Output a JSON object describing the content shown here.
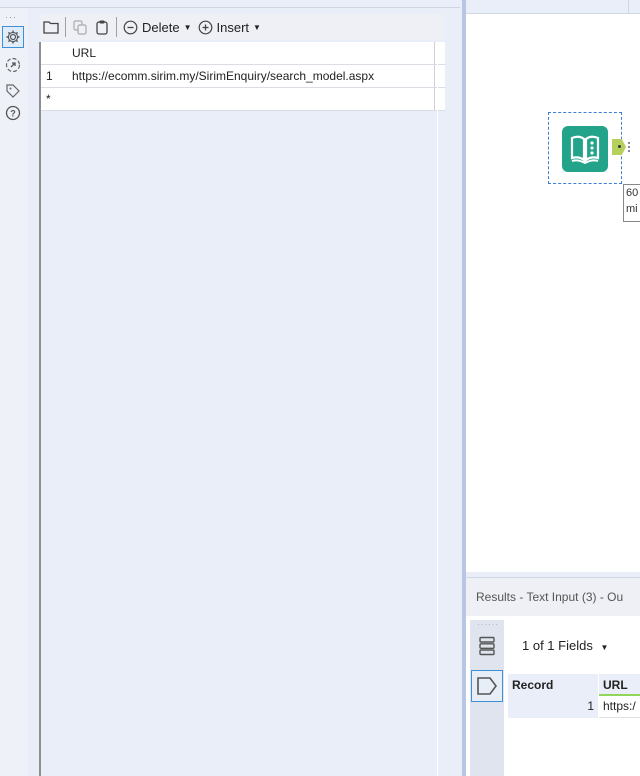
{
  "toolbar": {
    "open_icon": "folder-icon",
    "copy_icon": "copy-icon",
    "paste_icon": "paste-icon",
    "delete_label": "Delete",
    "insert_label": "Insert"
  },
  "sidebar": {
    "items": [
      {
        "name": "configuration",
        "icon": "gear-icon",
        "active": true
      },
      {
        "name": "output-anchor",
        "icon": "anchor-arrow-icon",
        "active": false
      },
      {
        "name": "annotation",
        "icon": "tag-icon",
        "active": false
      },
      {
        "name": "help",
        "icon": "help-icon",
        "active": false
      }
    ]
  },
  "grid": {
    "columns": [
      "URL"
    ],
    "rows": [
      {
        "num": "1",
        "values": [
          "https://ecomm.sirim.my/SirimEnquiry/search_model.aspx"
        ]
      }
    ],
    "new_row_marker": "*"
  },
  "canvas": {
    "tool_name": "Text Input",
    "tooltip_line1": "60",
    "tooltip_line2": "mi"
  },
  "results": {
    "title": "Results - Text Input (3) - Ou",
    "fields_label": "1 of 1 Fields",
    "columns": [
      "Record",
      "URL"
    ],
    "rows": [
      {
        "record": "1",
        "url": "https:/"
      }
    ]
  },
  "colors": {
    "tool_teal": "#22a38a",
    "anchor_green": "#b5d05c",
    "selection_blue": "#3d7fd6",
    "panel_bg": "#e9eef8"
  }
}
